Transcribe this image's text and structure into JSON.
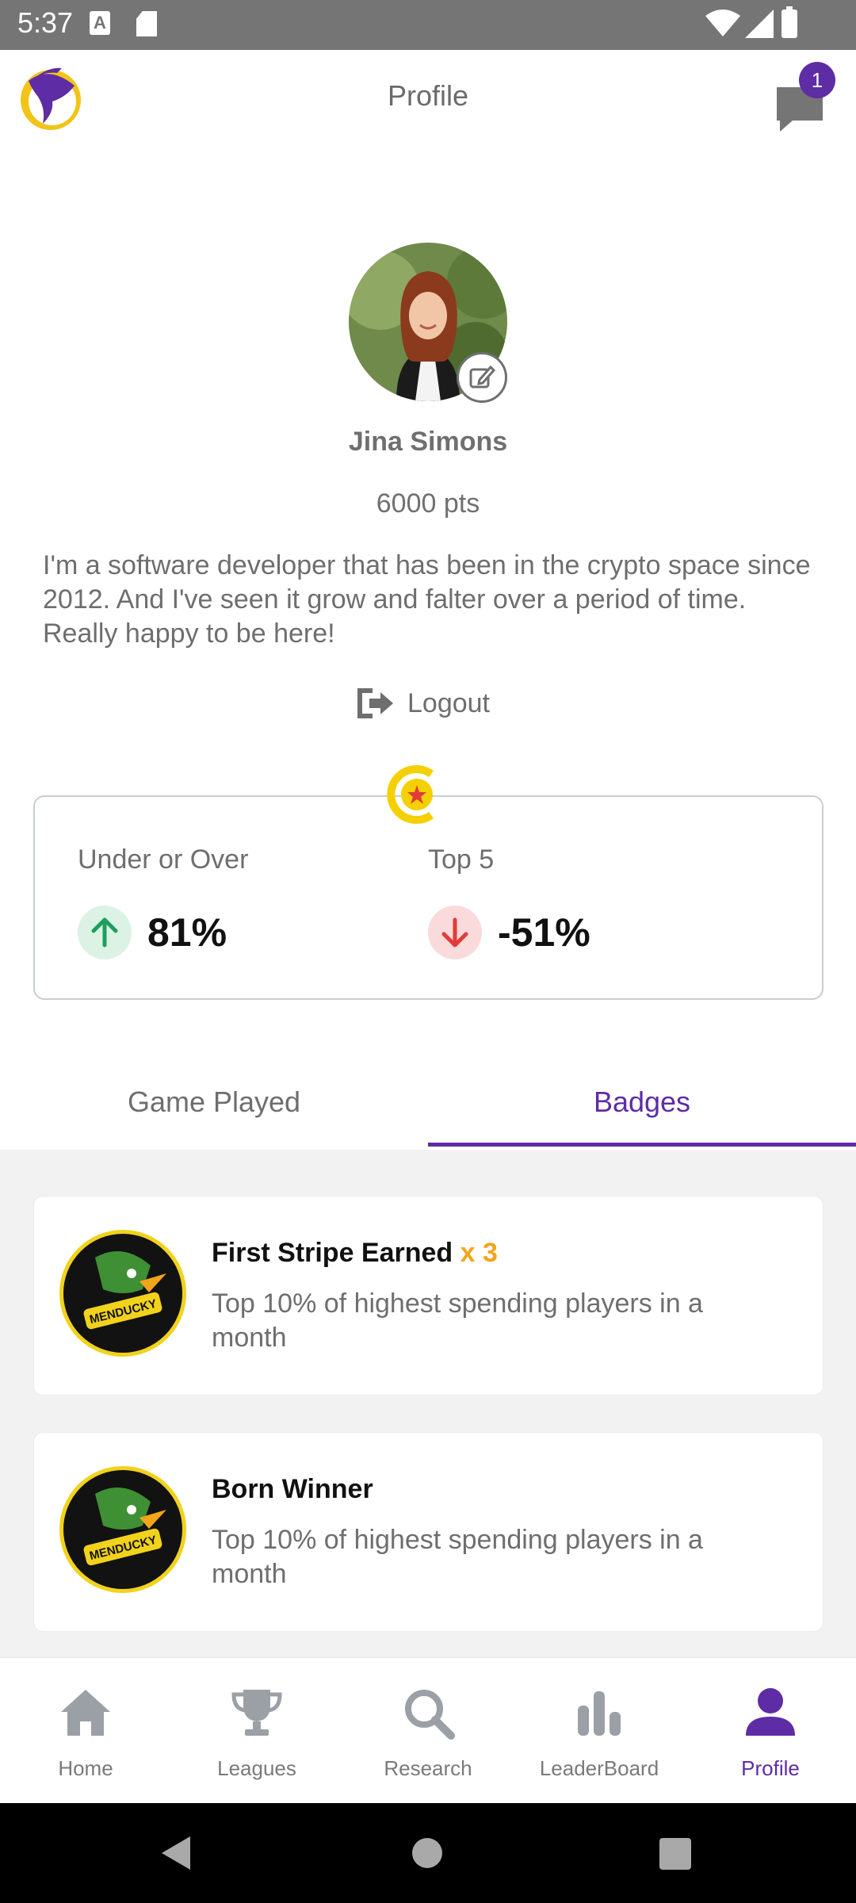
{
  "status_bar": {
    "time": "5:37",
    "a_icon_letter": "A"
  },
  "header": {
    "title": "Profile",
    "notification_count": "1"
  },
  "profile": {
    "name": "Jina Simons",
    "points": "6000 pts",
    "bio": "I'm a software developer that has been in the crypto space since 2012. And I've seen it grow and falter over a period of time. Really happy to be here!",
    "logout_label": "Logout"
  },
  "stats": {
    "left": {
      "label": "Under or Over",
      "value": "81%",
      "trend": "up"
    },
    "right": {
      "label": "Top 5",
      "value": "-51%",
      "trend": "down"
    }
  },
  "tabs": [
    {
      "label": "Game Played",
      "active": false
    },
    {
      "label": "Badges",
      "active": true
    }
  ],
  "badges": [
    {
      "title": "First Stripe Earned",
      "multiplier": "x 3",
      "description": "Top 10% of highest spending players in a month",
      "badge_text": "MENDUCKY"
    },
    {
      "title": "Born Winner",
      "multiplier": "",
      "description": "Top 10% of highest spending players in a month",
      "badge_text": "MENDUCKY"
    }
  ],
  "bottom_nav": [
    {
      "label": "Home",
      "icon": "home-icon"
    },
    {
      "label": "Leagues",
      "icon": "trophy-icon"
    },
    {
      "label": "Research",
      "icon": "search-icon"
    },
    {
      "label": "LeaderBoard",
      "icon": "bar-chart-icon"
    },
    {
      "label": "Profile",
      "icon": "person-icon",
      "active": true
    }
  ],
  "colors": {
    "accent": "#5e2ca5",
    "status_bar": "#757575",
    "up": "#1e9e5c",
    "down": "#e23b3b",
    "multiplier": "#f2a51b"
  }
}
